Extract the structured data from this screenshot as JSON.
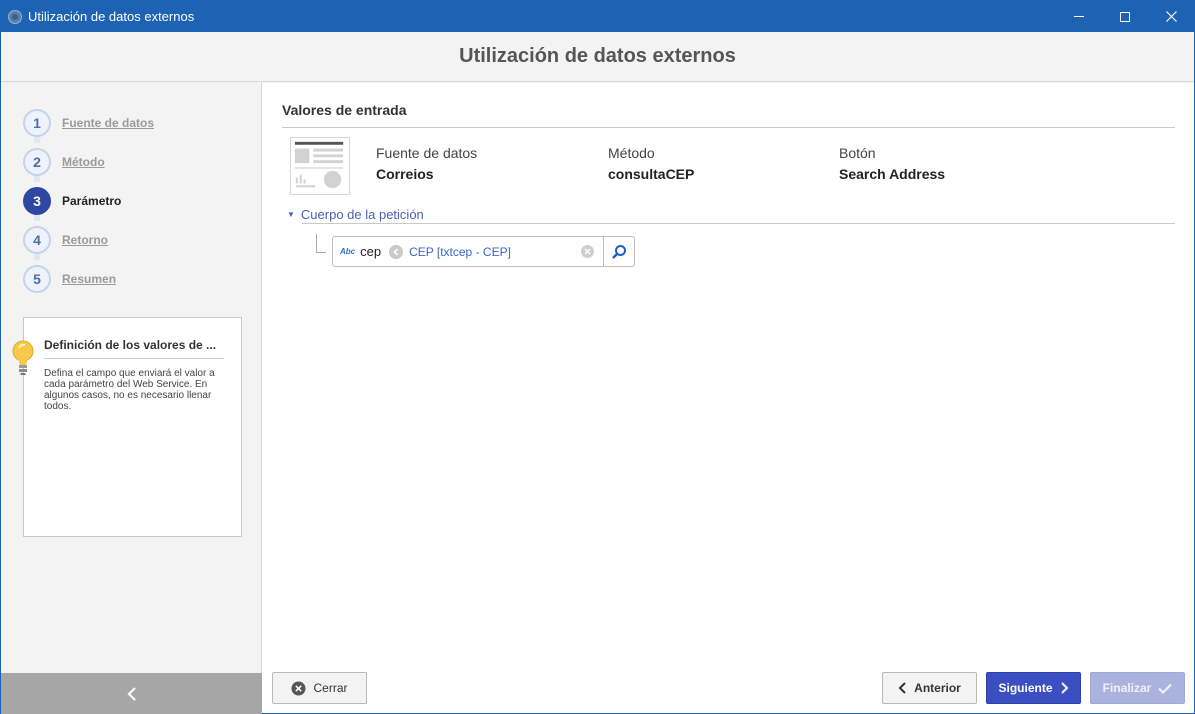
{
  "window": {
    "title": "Utilización de datos externos",
    "controls": [
      "minimize",
      "maximize",
      "close"
    ]
  },
  "header": {
    "title": "Utilización de datos externos"
  },
  "sidebar": {
    "steps": [
      {
        "number": "1",
        "label": "Fuente de datos",
        "active": false
      },
      {
        "number": "2",
        "label": "Método",
        "active": false
      },
      {
        "number": "3",
        "label": "Parámetro",
        "active": true
      },
      {
        "number": "4",
        "label": "Retorno",
        "active": false
      },
      {
        "number": "5",
        "label": "Resumen",
        "active": false
      }
    ],
    "tip": {
      "title": "Definición de los valores de ...",
      "text": "Defina el campo que enviará el valor a cada parámetro del Web Service. En algunos casos, no es necesario llenar todos."
    },
    "collapse_icon": "chevron-left-icon"
  },
  "main": {
    "section_title": "Valores de entrada",
    "info": [
      {
        "label": "Fuente de datos",
        "value": "Correios"
      },
      {
        "label": "Método",
        "value": "consultaCEP"
      },
      {
        "label": "Botón",
        "value": "Search Address"
      }
    ],
    "group_title": "Cuerpo de la petición",
    "parameter": {
      "type_badge": "Abc",
      "name": "cep",
      "value": "CEP [txtcep - CEP]"
    }
  },
  "footer": {
    "close_label": "Cerrar",
    "prev_label": "Anterior",
    "next_label": "Siguiente",
    "finish_label": "Finalizar"
  },
  "colors": {
    "titlebar": "#1e62b3",
    "active_step": "#2e47a1",
    "next_button": "#3b4fc0",
    "finish_button_disabled": "#aab3dd",
    "link": "#4a5fb0"
  }
}
